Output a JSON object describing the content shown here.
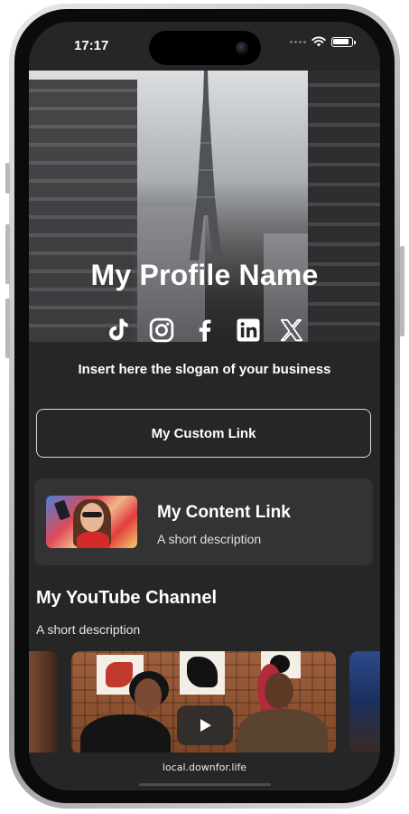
{
  "status_bar": {
    "time": "17:17"
  },
  "profile": {
    "name": "My Profile Name",
    "slogan": "Insert here the slogan of your business",
    "social_icons": [
      "tiktok-icon",
      "instagram-icon",
      "facebook-icon",
      "linkedin-icon",
      "x-icon"
    ]
  },
  "links": {
    "custom_link_label": "My Custom Link",
    "content_link": {
      "title": "My Content Link",
      "description": "A short description"
    }
  },
  "youtube": {
    "title": "My YouTube Channel",
    "description": "A short description"
  },
  "browser": {
    "url": "local.downfor.life"
  },
  "colors": {
    "background": "#262626",
    "card": "#333333",
    "text": "#ffffff",
    "button_border": "#d9d9d9"
  }
}
